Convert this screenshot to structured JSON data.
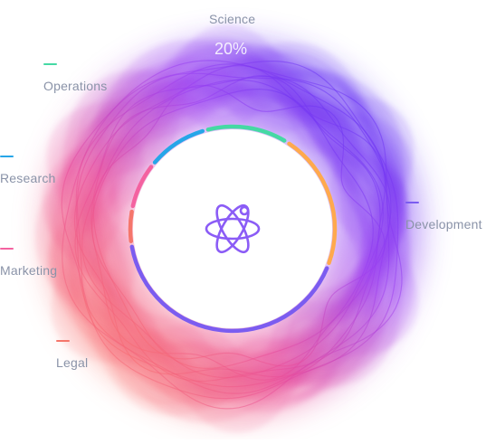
{
  "chart_data": {
    "type": "pie",
    "title": "",
    "center_icon": "atom-icon",
    "segments": [
      {
        "label": "Science",
        "color": "#ffa94d",
        "value": 20
      },
      {
        "label": "Development",
        "color": "#7b5cf0",
        "value": 38
      },
      {
        "label": "Legal",
        "color": "#f5766b",
        "value": 5
      },
      {
        "label": "Marketing",
        "color": "#f462a0",
        "value": 7
      },
      {
        "label": "Research",
        "color": "#26a6e8",
        "value": 9
      },
      {
        "label": "Operations",
        "color": "#45d9a4",
        "value": 12
      }
    ],
    "value_labels": {
      "Science": "20%"
    }
  }
}
